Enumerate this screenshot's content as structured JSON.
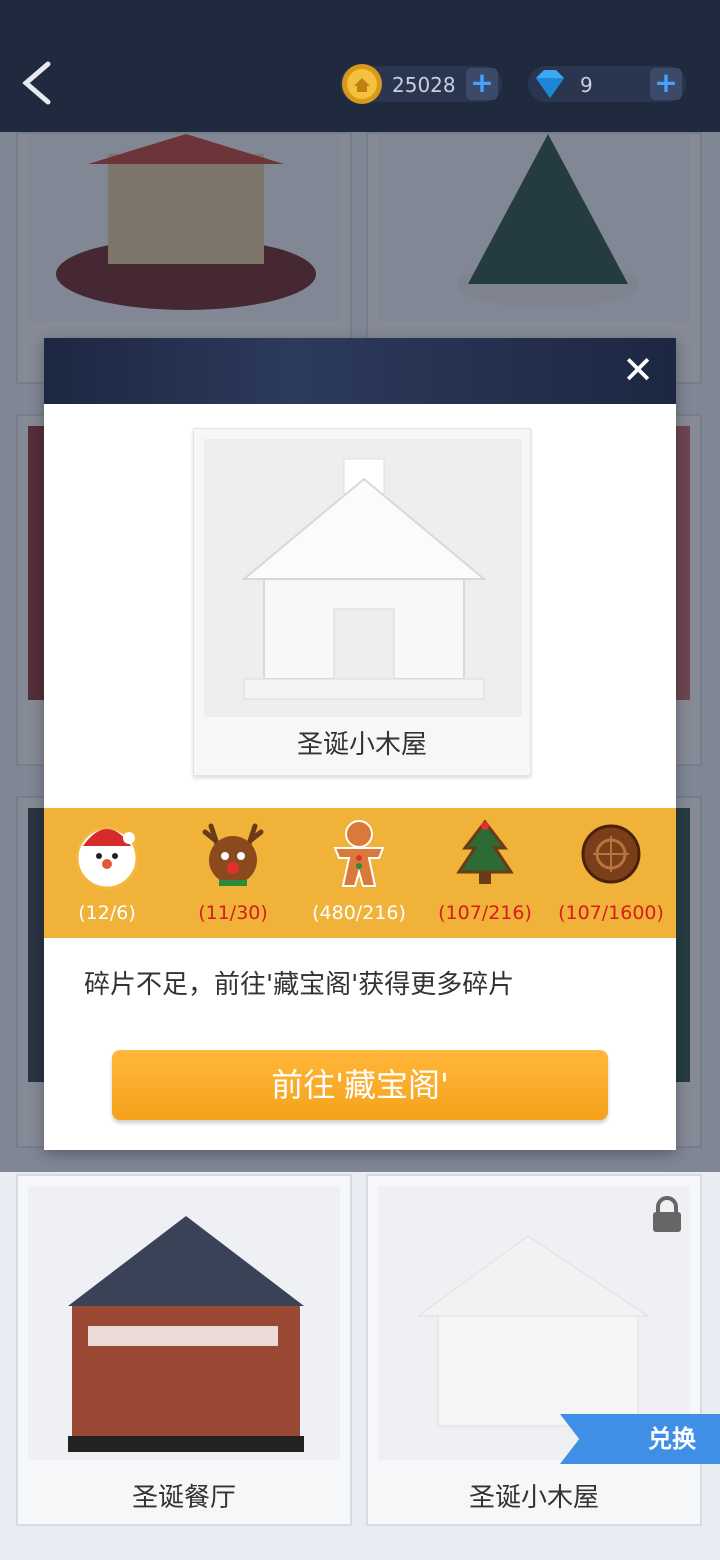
{
  "header": {
    "coins": "25028",
    "gems": "9",
    "plus": "+"
  },
  "grid": {
    "cards": [
      {
        "label": ""
      },
      {
        "label": ""
      },
      {
        "label": "圣诞餐厅"
      },
      {
        "label": "圣诞小木屋"
      }
    ],
    "exchange_ribbon": "兑换"
  },
  "modal": {
    "close_symbol": "✕",
    "item_name": "圣诞小木屋",
    "pieces": [
      {
        "icon": "santa-icon",
        "count": "(12/6)",
        "enough": true
      },
      {
        "icon": "reindeer-icon",
        "count": "(11/30)",
        "enough": false
      },
      {
        "icon": "gingerbread-icon",
        "count": "(480/216)",
        "enough": true
      },
      {
        "icon": "christmas-tree-icon",
        "count": "(107/216)",
        "enough": false
      },
      {
        "icon": "cookie-icon",
        "count": "(107/1600)",
        "enough": false
      }
    ],
    "message": "碎片不足，前往'藏宝阁'获得更多碎片",
    "button_label": "前往'藏宝阁'"
  },
  "colors": {
    "header_bg": "#1f2a3f",
    "pieces_bg": "#f1b23a",
    "button": "#f5a21b",
    "count_low": "#d61d1d"
  }
}
